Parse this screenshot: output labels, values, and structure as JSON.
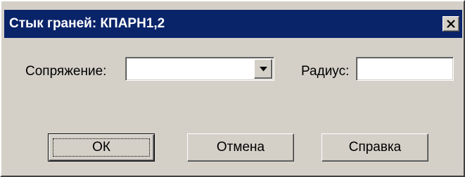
{
  "window": {
    "title": "Стык граней: КПАРН1,2"
  },
  "form": {
    "conjugation_label": "Сопряжение:",
    "conjugation_value": "",
    "radius_label": "Радиус:",
    "radius_value": ""
  },
  "buttons": {
    "ok": "ОК",
    "cancel": "Отмена",
    "help": "Справка"
  },
  "icons": {
    "close": "close-icon",
    "dropdown": "chevron-down-icon"
  },
  "colors": {
    "titlebar": "#0a246a",
    "face": "#d4d0c8"
  }
}
